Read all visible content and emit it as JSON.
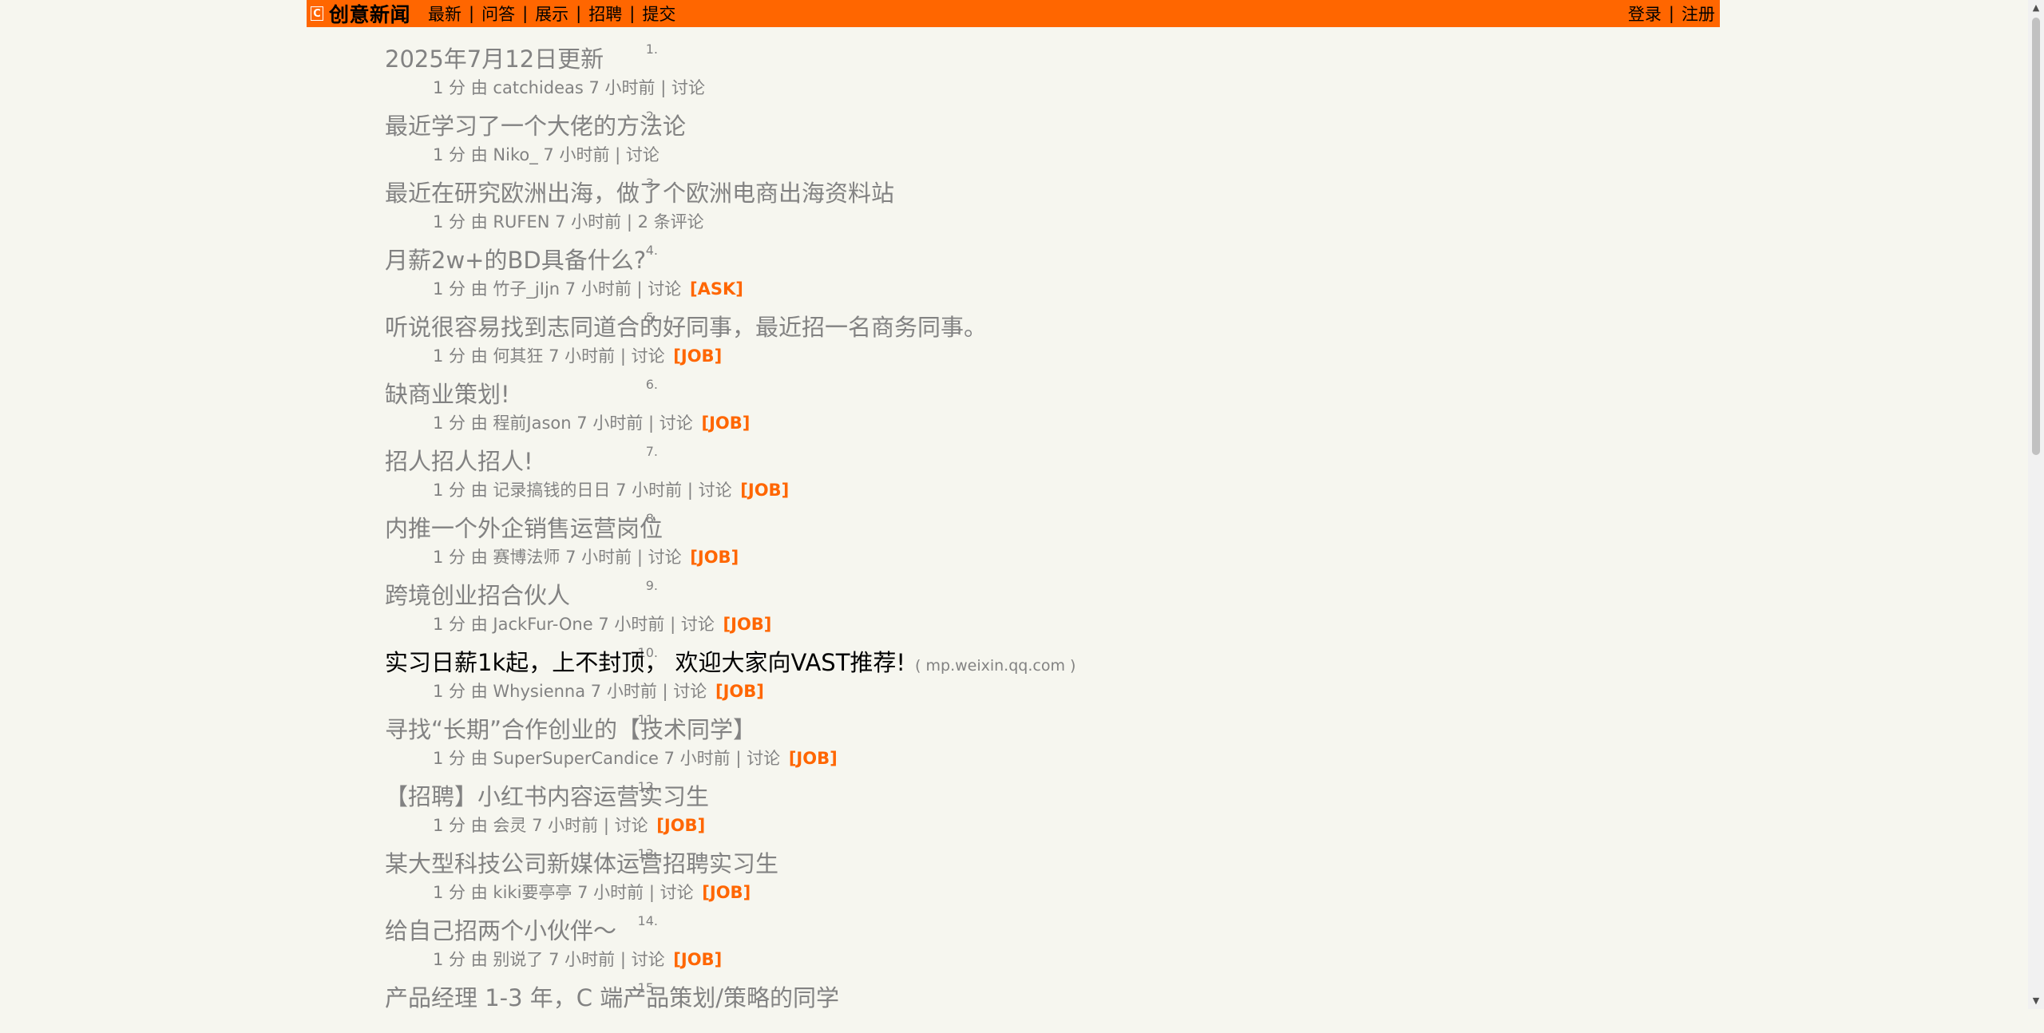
{
  "header": {
    "logo": "C",
    "site_name": "创意新闻",
    "nav": [
      "最新",
      "问答",
      "展示",
      "招聘",
      "提交"
    ],
    "auth": [
      "登录",
      "注册"
    ],
    "separator": "|"
  },
  "stories": [
    {
      "rank": "1.",
      "title": "2025年7月12日更新",
      "domain": "",
      "points": "1 分",
      "by": "由",
      "user": "catchideas",
      "age": "7 小时前",
      "comments": "讨论",
      "tag": "",
      "unvisited": false
    },
    {
      "rank": "2.",
      "title": "最近学习了一个大佬的方法论",
      "domain": "",
      "points": "1 分",
      "by": "由",
      "user": "Niko_",
      "age": "7 小时前",
      "comments": "讨论",
      "tag": "",
      "unvisited": false
    },
    {
      "rank": "3.",
      "title": "最近在研究欧洲出海，做了个欧洲电商出海资料站",
      "domain": "",
      "points": "1 分",
      "by": "由",
      "user": "RUFEN",
      "age": "7 小时前",
      "comments": "2 条评论",
      "tag": "",
      "unvisited": false
    },
    {
      "rank": "4.",
      "title": "月薪2w+的BD具备什么?",
      "domain": "",
      "points": "1 分",
      "by": "由",
      "user": "竹子_jIjn",
      "age": "7 小时前",
      "comments": "讨论",
      "tag": "[ASK]",
      "unvisited": false
    },
    {
      "rank": "5.",
      "title": "听说很容易找到志同道合的好同事，最近招一名商务同事。",
      "domain": "",
      "points": "1 分",
      "by": "由",
      "user": "何其狂",
      "age": "7 小时前",
      "comments": "讨论",
      "tag": "[JOB]",
      "unvisited": false
    },
    {
      "rank": "6.",
      "title": "缺商业策划!",
      "domain": "",
      "points": "1 分",
      "by": "由",
      "user": "程前Jason",
      "age": "7 小时前",
      "comments": "讨论",
      "tag": "[JOB]",
      "unvisited": false
    },
    {
      "rank": "7.",
      "title": "招人招人招人!",
      "domain": "",
      "points": "1 分",
      "by": "由",
      "user": "记录搞钱的日日",
      "age": "7 小时前",
      "comments": "讨论",
      "tag": "[JOB]",
      "unvisited": false
    },
    {
      "rank": "8.",
      "title": "内推一个外企销售运营岗位",
      "domain": "",
      "points": "1 分",
      "by": "由",
      "user": "赛博法师",
      "age": "7 小时前",
      "comments": "讨论",
      "tag": "[JOB]",
      "unvisited": false
    },
    {
      "rank": "9.",
      "title": "跨境创业招合伙人",
      "domain": "",
      "points": "1 分",
      "by": "由",
      "user": "JackFur-One",
      "age": "7 小时前",
      "comments": "讨论",
      "tag": "[JOB]",
      "unvisited": false
    },
    {
      "rank": "10.",
      "title": "实习日薪1k起，上不封顶， 欢迎大家向VAST推荐!",
      "domain": "mp.weixin.qq.com",
      "points": "1 分",
      "by": "由",
      "user": "Whysienna",
      "age": "7 小时前",
      "comments": "讨论",
      "tag": "[JOB]",
      "unvisited": true
    },
    {
      "rank": "11.",
      "title": "寻找“长期”合作创业的【技术同学】",
      "domain": "",
      "points": "1 分",
      "by": "由",
      "user": "SuperSuperCandice",
      "age": "7 小时前",
      "comments": "讨论",
      "tag": "[JOB]",
      "unvisited": false
    },
    {
      "rank": "12.",
      "title": "【招聘】小红书内容运营实习生",
      "domain": "",
      "points": "1 分",
      "by": "由",
      "user": "会灵",
      "age": "7 小时前",
      "comments": "讨论",
      "tag": "[JOB]",
      "unvisited": false
    },
    {
      "rank": "13.",
      "title": "某大型科技公司新媒体运营招聘实习生",
      "domain": "",
      "points": "1 分",
      "by": "由",
      "user": "kiki要亭亭",
      "age": "7 小时前",
      "comments": "讨论",
      "tag": "[JOB]",
      "unvisited": false
    },
    {
      "rank": "14.",
      "title": "给自己招两个小伙伴～",
      "domain": "",
      "points": "1 分",
      "by": "由",
      "user": "别说了",
      "age": "7 小时前",
      "comments": "讨论",
      "tag": "[JOB]",
      "unvisited": false
    },
    {
      "rank": "15.",
      "title": "产品经理 1-3 年，C 端产品策划/策略的同学",
      "domain": "",
      "points": "",
      "by": "",
      "user": "",
      "age": "",
      "comments": "",
      "tag": "",
      "unvisited": false
    }
  ],
  "colors": {
    "accent": "#ff6600",
    "background": "#f6f6ef",
    "muted": "#828282"
  },
  "icons": {
    "scroll_up": "triangle-up-icon",
    "scroll_down": "triangle-down-icon"
  }
}
